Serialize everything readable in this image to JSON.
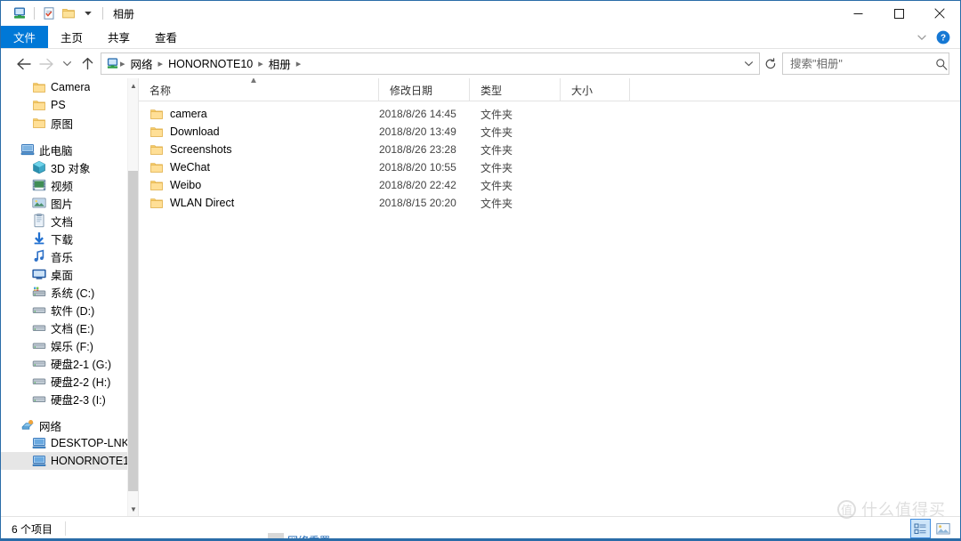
{
  "window": {
    "title": "相册",
    "quick_access": [
      {
        "name": "pc-icon",
        "label": "此电脑"
      },
      {
        "name": "properties-icon",
        "label": "属性"
      },
      {
        "name": "new-folder-icon",
        "label": "新建文件夹"
      },
      {
        "name": "customize-dropdown-icon",
        "label": "自定义快速访问工具栏"
      }
    ],
    "controls": [
      {
        "name": "minimize-button",
        "glyph": "minimize"
      },
      {
        "name": "maximize-button",
        "glyph": "maximize"
      },
      {
        "name": "close-button",
        "glyph": "close"
      }
    ]
  },
  "ribbon": {
    "tabs": [
      {
        "label": "文件",
        "active": true
      },
      {
        "label": "主页",
        "active": false
      },
      {
        "label": "共享",
        "active": false
      },
      {
        "label": "查看",
        "active": false
      }
    ],
    "collapse_label": "展开功能区",
    "help_label": "帮助"
  },
  "navigation": {
    "back_label": "后退",
    "forward_label": "前进",
    "recent_label": "最近浏览的位置",
    "up_label": "上移到",
    "refresh_label": "刷新",
    "breadcrumb": [
      "网络",
      "HONORNOTE10",
      "相册"
    ],
    "address_dropdown_label": "以前的位置"
  },
  "search": {
    "placeholder": "搜索\"相册\"",
    "value": "",
    "icon": "search-icon"
  },
  "sidebar": {
    "items": [
      {
        "label": "Camera",
        "icon": "folder-icon",
        "indent": 2,
        "selected": false
      },
      {
        "label": "PS",
        "icon": "folder-icon",
        "indent": 2,
        "selected": false
      },
      {
        "label": "原图",
        "icon": "folder-icon",
        "indent": 2,
        "selected": false
      },
      {
        "label": "",
        "icon": "spacer",
        "indent": 0,
        "spacer": true,
        "selected": false
      },
      {
        "label": "此电脑",
        "icon": "computer-icon",
        "indent": 1,
        "selected": false
      },
      {
        "label": "3D 对象",
        "icon": "3d-objects-icon",
        "indent": 2,
        "selected": false
      },
      {
        "label": "视频",
        "icon": "videos-icon",
        "indent": 2,
        "selected": false
      },
      {
        "label": "图片",
        "icon": "pictures-icon",
        "indent": 2,
        "selected": false
      },
      {
        "label": "文档",
        "icon": "documents-icon",
        "indent": 2,
        "selected": false
      },
      {
        "label": "下载",
        "icon": "downloads-icon",
        "indent": 2,
        "selected": false
      },
      {
        "label": "音乐",
        "icon": "music-icon",
        "indent": 2,
        "selected": false
      },
      {
        "label": "桌面",
        "icon": "desktop-icon",
        "indent": 2,
        "selected": false
      },
      {
        "label": "系统 (C:)",
        "icon": "system-drive-icon",
        "indent": 2,
        "selected": false
      },
      {
        "label": "软件 (D:)",
        "icon": "drive-icon",
        "indent": 2,
        "selected": false
      },
      {
        "label": "文档 (E:)",
        "icon": "drive-icon",
        "indent": 2,
        "selected": false
      },
      {
        "label": "娱乐 (F:)",
        "icon": "drive-icon",
        "indent": 2,
        "selected": false
      },
      {
        "label": "硬盘2-1 (G:)",
        "icon": "drive-icon",
        "indent": 2,
        "selected": false
      },
      {
        "label": "硬盘2-2 (H:)",
        "icon": "drive-icon",
        "indent": 2,
        "selected": false
      },
      {
        "label": "硬盘2-3 (I:)",
        "icon": "drive-icon",
        "indent": 2,
        "selected": false
      },
      {
        "label": "",
        "icon": "spacer",
        "indent": 0,
        "spacer": true,
        "selected": false
      },
      {
        "label": "网络",
        "icon": "network-icon",
        "indent": 1,
        "selected": false
      },
      {
        "label": "DESKTOP-LNK",
        "icon": "computer-node-icon",
        "indent": 2,
        "selected": false
      },
      {
        "label": "HONORNOTE1",
        "icon": "computer-node-icon",
        "indent": 2,
        "selected": true
      }
    ]
  },
  "file_list": {
    "columns": [
      {
        "label": "名称",
        "sorted": true,
        "sort_dir": "asc"
      },
      {
        "label": "修改日期",
        "sorted": false
      },
      {
        "label": "类型",
        "sorted": false
      },
      {
        "label": "大小",
        "sorted": false
      }
    ],
    "rows": [
      {
        "name": "camera",
        "date": "2018/8/26 14:45",
        "type": "文件夹",
        "size": "",
        "icon": "folder-icon"
      },
      {
        "name": "Download",
        "date": "2018/8/20 13:49",
        "type": "文件夹",
        "size": "",
        "icon": "folder-icon"
      },
      {
        "name": "Screenshots",
        "date": "2018/8/26 23:28",
        "type": "文件夹",
        "size": "",
        "icon": "folder-icon"
      },
      {
        "name": "WeChat",
        "date": "2018/8/20 10:55",
        "type": "文件夹",
        "size": "",
        "icon": "folder-icon"
      },
      {
        "name": "Weibo",
        "date": "2018/8/20 22:42",
        "type": "文件夹",
        "size": "",
        "icon": "folder-icon"
      },
      {
        "name": "WLAN Direct",
        "date": "2018/8/15 20:20",
        "type": "文件夹",
        "size": "",
        "icon": "folder-icon"
      }
    ]
  },
  "statusbar": {
    "item_count": "6 个项目",
    "view_buttons": [
      {
        "name": "details-view-button",
        "label": "详细信息",
        "active": true
      },
      {
        "name": "large-icons-view-button",
        "label": "大图标",
        "active": false
      }
    ]
  },
  "background": {
    "partial_text": "网络重置"
  },
  "watermark": {
    "mark": "值",
    "text": "什么值得买"
  },
  "colors": {
    "accent": "#0078d7",
    "folder": "#ffd976",
    "window_border": "#2a6ca8",
    "selection": "#e6e6e6",
    "scrollbar_thumb": "#cdcdcd"
  }
}
